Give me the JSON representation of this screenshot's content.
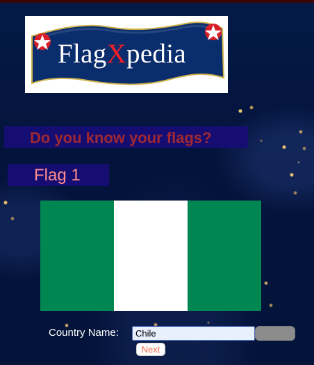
{
  "app": {
    "logo_text_before": "Flag",
    "logo_text_x": "X",
    "logo_text_after": "pedia"
  },
  "quiz": {
    "question": "Do you know your flags?",
    "flag_label": "Flag 1"
  },
  "flag": {
    "bands": [
      {
        "color": "#008751"
      },
      {
        "color": "#ffffff"
      },
      {
        "color": "#008751"
      }
    ]
  },
  "form": {
    "country_label": "Country Name:",
    "country_value": "Chile",
    "next_label": "Next"
  },
  "colors": {
    "background": "#031238",
    "banner_fill": "#160d73",
    "question_text": "#a02830",
    "flag_label_text": "#ff8d8d",
    "logo_red": "#f42127"
  }
}
